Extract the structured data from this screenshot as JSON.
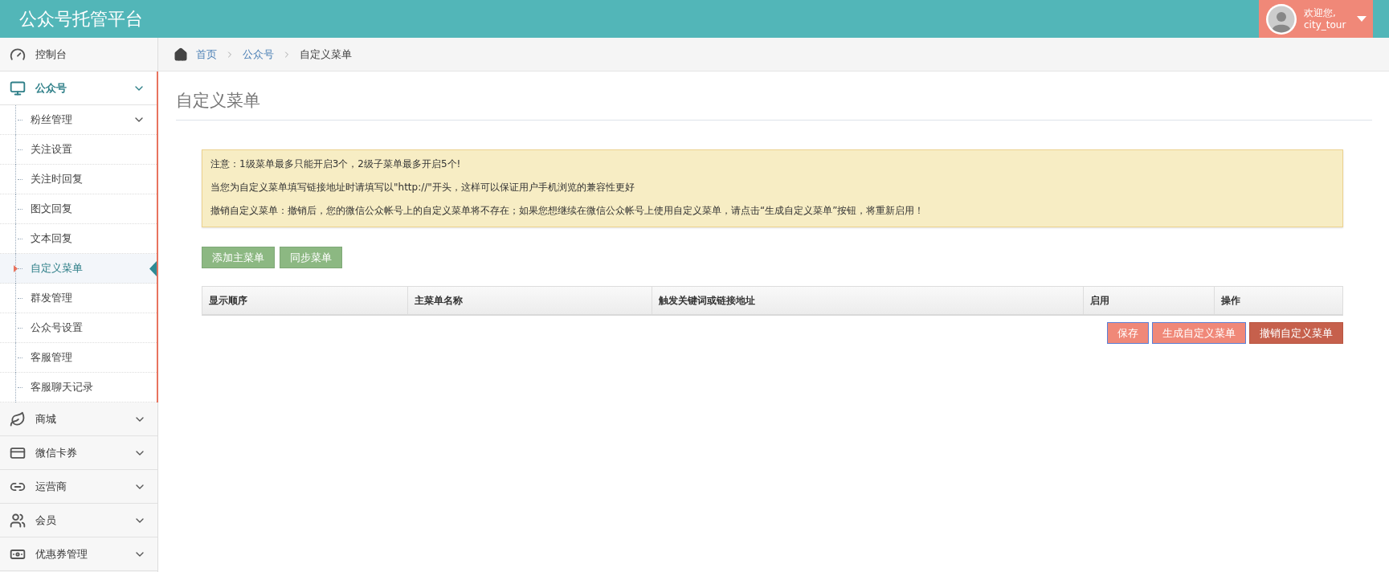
{
  "header": {
    "title": "公众号托管平台",
    "user": {
      "greeting": "欢迎您,",
      "name": "city_tour"
    }
  },
  "sidebar": {
    "items": [
      {
        "label": "控制台",
        "selected": false,
        "kind": "link"
      },
      {
        "label": "公众号",
        "selected": true,
        "kind": "group",
        "expanded": true,
        "children": [
          {
            "label": "粉丝管理",
            "selected": false,
            "expandable": true
          },
          {
            "label": "关注设置",
            "selected": false,
            "expandable": false
          },
          {
            "label": "关注时回复",
            "selected": false,
            "expandable": false
          },
          {
            "label": "图文回复",
            "selected": false,
            "expandable": false
          },
          {
            "label": "文本回复",
            "selected": false,
            "expandable": false
          },
          {
            "label": "自定义菜单",
            "selected": true,
            "expandable": false
          },
          {
            "label": "群发管理",
            "selected": false,
            "expandable": false
          },
          {
            "label": "公众号设置",
            "selected": false,
            "expandable": false
          },
          {
            "label": "客服管理",
            "selected": false,
            "expandable": false
          },
          {
            "label": "客服聊天记录",
            "selected": false,
            "expandable": false
          }
        ]
      },
      {
        "label": "商城",
        "selected": false,
        "kind": "group"
      },
      {
        "label": "微信卡券",
        "selected": false,
        "kind": "group"
      },
      {
        "label": "运营商",
        "selected": false,
        "kind": "group"
      },
      {
        "label": "会员",
        "selected": false,
        "kind": "group"
      },
      {
        "label": "优惠券管理",
        "selected": false,
        "kind": "group"
      }
    ]
  },
  "breadcrumb": [
    {
      "label": "首页",
      "kind": "link"
    },
    {
      "label": "公众号",
      "kind": "link"
    },
    {
      "label": "自定义菜单",
      "kind": "current"
    }
  ],
  "page_title": "自定义菜单",
  "notice": [
    "注意：1级菜单最多只能开启3个，2级子菜单最多开启5个!",
    "当您为自定义菜单填写链接地址时请填写以\"http://\"开头，这样可以保证用户手机浏览的兼容性更好",
    "撤销自定义菜单：撤销后，您的微信公众帐号上的自定义菜单将不存在；如果您想继续在微信公众帐号上使用自定义菜单，请点击“生成自定义菜单”按钮，将重新启用！"
  ],
  "top_buttons": [
    "添加主菜单",
    "同步菜单"
  ],
  "table": {
    "columns": [
      "显示顺序",
      "主菜单名称",
      "触发关键词或链接地址",
      "启用",
      "操作"
    ]
  },
  "bottom_buttons": [
    {
      "label": "保存",
      "kind": "primary"
    },
    {
      "label": "生成自定义菜单",
      "kind": "primary"
    },
    {
      "label": "撤销自定义菜单",
      "kind": "danger"
    }
  ]
}
